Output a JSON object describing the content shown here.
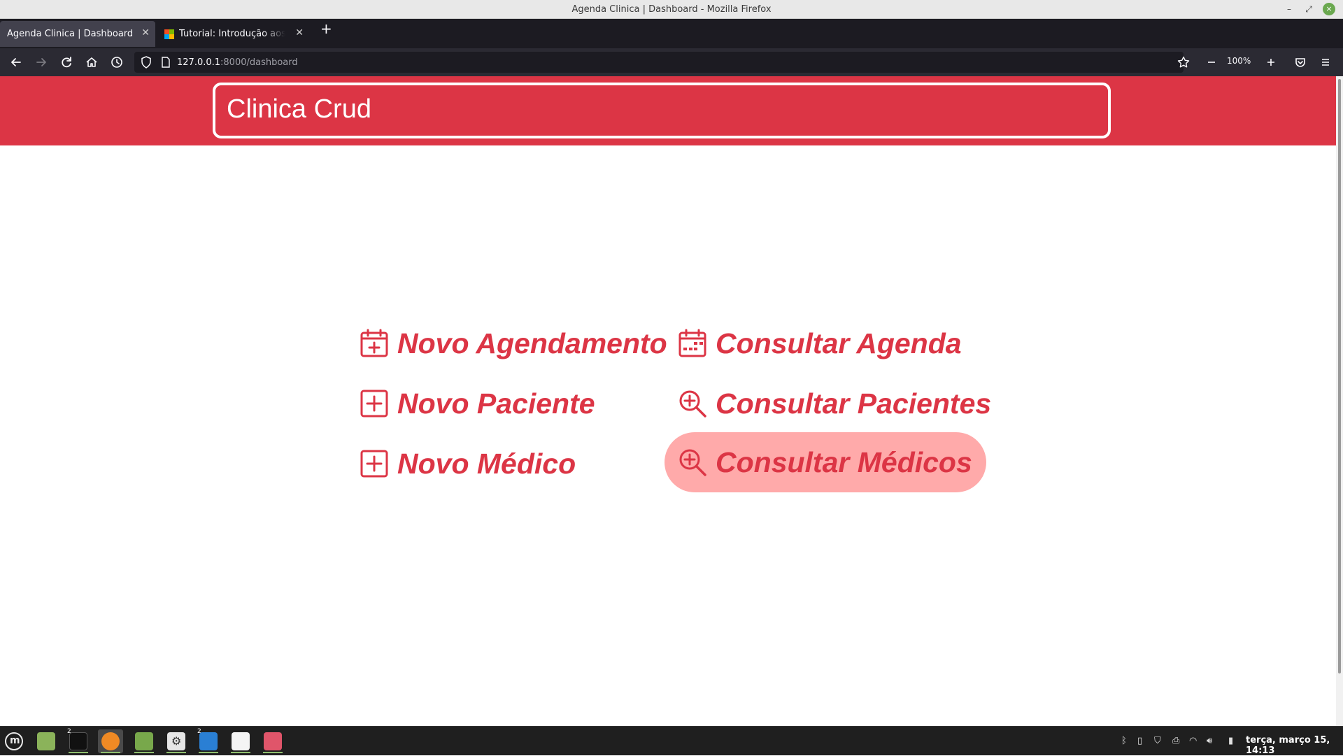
{
  "window": {
    "title": "Agenda Clinica | Dashboard - Mozilla Firefox",
    "controls": {
      "minimize": "–",
      "maximize": "⤢",
      "close": "×"
    }
  },
  "tabs": [
    {
      "label": "Agenda Clinica | Dashboard",
      "active": true
    },
    {
      "label": "Tutorial: Introdução aos aplicativos",
      "active": false
    }
  ],
  "tab_close_glyph": "✕",
  "new_tab_glyph": "+",
  "navbar": {
    "url_host": "127.0.0.1",
    "url_path": ":8000/dashboard",
    "zoom_level": "100%",
    "icons": [
      "back-arrow-icon",
      "forward-arrow-icon",
      "reload-icon",
      "home-icon",
      "history-icon",
      "shield-icon",
      "page-icon",
      "bookmark-star-icon",
      "zoom-out-icon",
      "zoom-in-icon",
      "pocket-icon",
      "menu-icon"
    ]
  },
  "page": {
    "brand": "Clinica Crud",
    "accent_color": "#dc3545",
    "hover_color": "#ffaaaa",
    "menu": [
      {
        "label": "Novo Agendamento",
        "icon": "calendar-plus-icon"
      },
      {
        "label": "Consultar Agenda",
        "icon": "calendar-week-icon"
      },
      {
        "label": "Novo Paciente",
        "icon": "plus-square-icon"
      },
      {
        "label": "Consultar Pacientes",
        "icon": "zoom-in-icon"
      },
      {
        "label": "Novo Médico",
        "icon": "plus-square-icon"
      },
      {
        "label": "Consultar Médicos",
        "icon": "zoom-in-icon",
        "hovered": true
      }
    ]
  },
  "taskbar": {
    "clock": "terça, março 15, 14:13",
    "badges": {
      "terminal": "2",
      "vscode": "2"
    },
    "apps": [
      "mint-menu-icon",
      "show-desktop-icon",
      "terminal-icon",
      "firefox-icon",
      "files-icon",
      "settings-icon",
      "vscode-icon",
      "inkscape-icon",
      "image-viewer-icon"
    ],
    "tray": [
      "bluetooth-icon",
      "clipboard-icon",
      "update-shield-icon",
      "printer-icon",
      "wifi-icon",
      "volume-icon",
      "battery-icon"
    ]
  }
}
